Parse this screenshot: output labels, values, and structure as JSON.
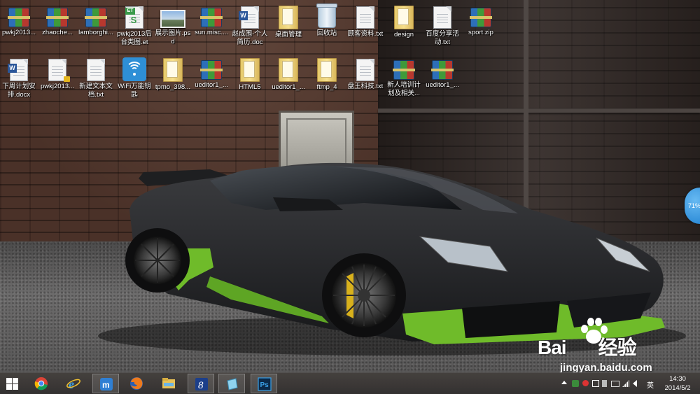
{
  "desktop": {
    "icons_row1": [
      {
        "label": "pwkj2013...",
        "icon": "winrar-archive-icon",
        "type": "rar"
      },
      {
        "label": "zhaoche...",
        "icon": "winrar-archive-icon",
        "type": "rar"
      },
      {
        "label": "lamborghi...",
        "icon": "winrar-archive-icon",
        "type": "rar"
      },
      {
        "label": "pwkj2013后台类图.et",
        "icon": "wps-spreadsheet-icon",
        "type": "et"
      },
      {
        "label": "展示图片.psd",
        "icon": "image-file-icon",
        "type": "image"
      },
      {
        "label": "sun.misc....",
        "icon": "winrar-archive-icon",
        "type": "rar"
      },
      {
        "label": "赵成围-个人简历.doc",
        "icon": "word-document-icon",
        "type": "word"
      },
      {
        "label": "桌面管理",
        "icon": "folder-icon",
        "type": "folder"
      },
      {
        "label": "回收站",
        "icon": "recycle-bin-icon",
        "type": "recycle"
      },
      {
        "label": "顾客资料.txt",
        "icon": "text-file-icon",
        "type": "file"
      },
      {
        "label": "design",
        "icon": "folder-icon",
        "type": "folder"
      },
      {
        "label": "百度分享活动.txt",
        "icon": "text-file-icon",
        "type": "file"
      },
      {
        "label": "sport.zip",
        "icon": "winrar-archive-icon",
        "type": "rar"
      }
    ],
    "icons_row2": [
      {
        "label": "下周计划安排.docx",
        "icon": "word-document-icon",
        "type": "word"
      },
      {
        "label": "pwkj2013...",
        "icon": "locked-file-icon",
        "type": "lock"
      },
      {
        "label": "新建文本文档.txt",
        "icon": "text-file-icon",
        "type": "file"
      },
      {
        "label": "WiFi万能钥匙",
        "icon": "wifi-key-app-icon",
        "type": "wifi"
      },
      {
        "label": "tpmo_398...",
        "icon": "folder-icon",
        "type": "folder"
      },
      {
        "label": "ueditor1_...",
        "icon": "winrar-archive-icon",
        "type": "rar"
      },
      {
        "label": "HTML5",
        "icon": "folder-icon",
        "type": "folder"
      },
      {
        "label": "ueditor1_...",
        "icon": "folder-icon",
        "type": "folder"
      },
      {
        "label": "ftmp_4",
        "icon": "folder-icon",
        "type": "folder"
      },
      {
        "label": "盘王科技.txt",
        "icon": "text-file-icon",
        "type": "file"
      },
      {
        "label": "新人培训计划及相关...",
        "icon": "winrar-archive-icon",
        "type": "rar"
      },
      {
        "label": "ueditor1_...",
        "icon": "winrar-archive-icon",
        "type": "rar"
      }
    ],
    "widget_percent": "71%"
  },
  "watermark": {
    "brand_left": "Bai",
    "brand_right": "经验",
    "url": "jingyan.baidu.com"
  },
  "taskbar": {
    "start_icon": "windows-start-icon",
    "apps": [
      {
        "name": "chrome",
        "icon": "chrome-icon",
        "active": false
      },
      {
        "name": "ie",
        "icon": "internet-explorer-icon",
        "active": false
      },
      {
        "name": "maxthon",
        "icon": "maxthon-icon",
        "active": true
      },
      {
        "name": "firefox",
        "icon": "firefox-icon",
        "active": false
      },
      {
        "name": "explorer",
        "icon": "file-explorer-icon",
        "active": false
      },
      {
        "name": "app8",
        "icon": "app-8-icon",
        "active": true
      },
      {
        "name": "app-blue",
        "icon": "blue-app-icon",
        "active": true
      },
      {
        "name": "photoshop",
        "icon": "photoshop-icon",
        "active": true
      }
    ],
    "tray": {
      "ime_label": "英",
      "time": "14:30",
      "date": "2014/5/2"
    }
  },
  "colors": {
    "taskbar_bg": "#3a3736",
    "car_green": "#6fbb2a",
    "widget_blue": "#2b8ddb"
  }
}
